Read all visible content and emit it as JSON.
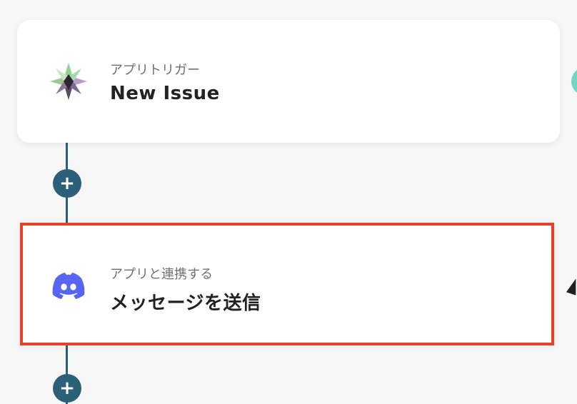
{
  "colors": {
    "background": "#f7f7f8",
    "connector": "#2c5f78",
    "selected_border": "#e8412b",
    "discord_brand": "#5865f2"
  },
  "flow": {
    "steps": [
      {
        "label": "アプリトリガー",
        "title": "New Issue",
        "icon": "app-trigger-star-icon"
      },
      {
        "label": "アプリと連携する",
        "title": "メッセージを送信",
        "icon": "discord-icon",
        "selected": true
      }
    ],
    "add_step_symbol": "+"
  }
}
